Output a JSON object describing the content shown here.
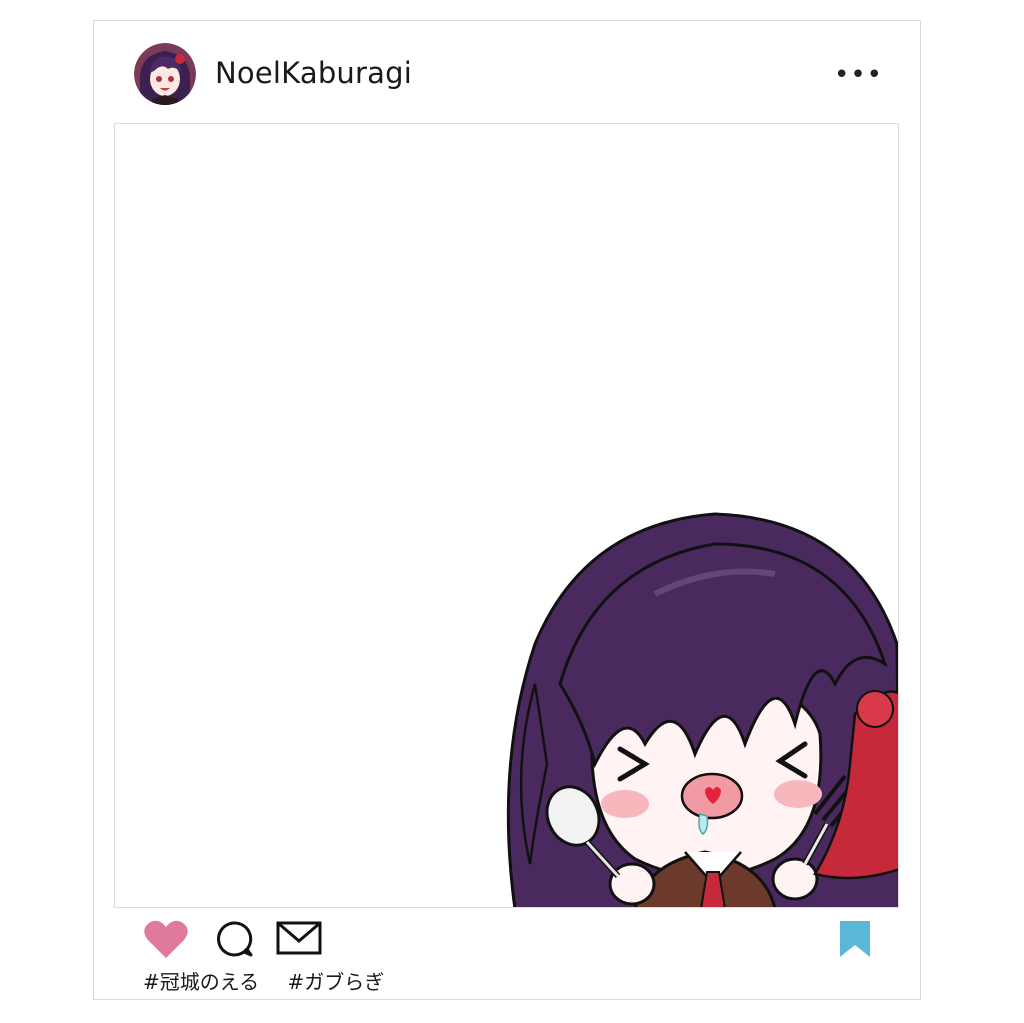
{
  "post": {
    "username": "NoelKaburagi",
    "more_label": "•••",
    "hashtags": [
      "#冠城のえる",
      "#ガブらぎ"
    ]
  },
  "icons": {
    "avatar": "avatar",
    "more": "more-options-icon",
    "like": "heart-icon",
    "comment": "comment-bubble-icon",
    "share": "envelope-icon",
    "bookmark": "bookmark-icon"
  },
  "colors": {
    "like": "#e07a9a",
    "bookmark": "#5bb7d6",
    "border": "#d9d9d9",
    "hair": "#4a2a5e"
  }
}
